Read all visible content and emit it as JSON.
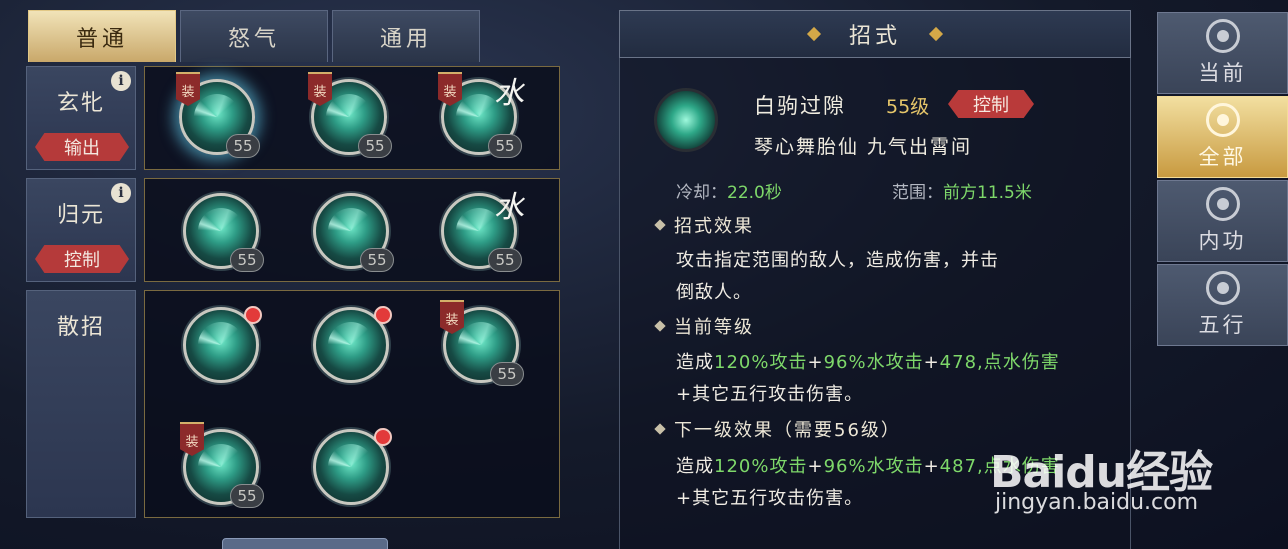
{
  "tabs": [
    {
      "label": "普通",
      "active": true
    },
    {
      "label": "怒气",
      "active": false
    },
    {
      "label": "通用",
      "active": false
    }
  ],
  "skill_groups": [
    {
      "name": "玄牝",
      "role": "输出",
      "info_icon": "info-icon",
      "skills": [
        {
          "level": "55",
          "equip_tag": "装",
          "selected": true
        },
        {
          "level": "55",
          "equip_tag": "装"
        },
        {
          "level": "55",
          "equip_tag": "装",
          "ink_mark": "水"
        }
      ]
    },
    {
      "name": "归元",
      "role": "控制",
      "info_icon": "info-icon",
      "skills": [
        {
          "level": "55"
        },
        {
          "level": "55"
        },
        {
          "level": "55",
          "ink_mark": "水"
        }
      ]
    },
    {
      "name": "散招",
      "skills": [
        {
          "red_dot": true
        },
        {
          "red_dot": true
        },
        {
          "level": "55",
          "equip_tag": "装"
        },
        {
          "level": "55",
          "equip_tag": "装"
        },
        {
          "red_dot": true
        }
      ]
    }
  ],
  "detail": {
    "header": "招式",
    "skill_name": "白驹过隙",
    "skill_level": "55级",
    "type_tag": "控制",
    "subtitle": "琴心舞胎仙 九气出霄间",
    "cooldown_label": "冷却：",
    "cooldown_value": "22.0秒",
    "range_label": "范围：",
    "range_value": "前方11.5米",
    "effect_title": "招式效果",
    "effect_line1": "攻击指定范围的敌人，造成伤害，并击",
    "effect_line2": "倒敌人。",
    "current_title": "当前等级",
    "current_line1": {
      "a": "造成",
      "b": "120%攻击",
      "c": "+",
      "d": "96%水攻击",
      "e": "+",
      "f": "478,点水伤害"
    },
    "current_line2": "+其它五行攻击伤害。",
    "next_title": "下一级效果（需要56级）",
    "next_line1": {
      "a": "造成",
      "b": "120%攻击",
      "c": "+",
      "d": "96%水攻击",
      "e": "+",
      "f": "487,点水伤害"
    },
    "next_line2": "+其它五行攻击伤害。"
  },
  "side_nav": [
    {
      "label": "当前",
      "icon": "current-icon",
      "active": false
    },
    {
      "label": "全部",
      "icon": "all-icon",
      "active": true
    },
    {
      "label": "内功",
      "icon": "inner-power-icon",
      "active": false
    },
    {
      "label": "五行",
      "icon": "five-elements-icon",
      "active": false
    }
  ],
  "watermark": {
    "logo": "Baidu经验",
    "url": "jingyan.baidu.com"
  },
  "colors": {
    "accent_gold": "#d4a848",
    "tag_red": "#b53a3a",
    "value_green": "#7ed86a"
  }
}
